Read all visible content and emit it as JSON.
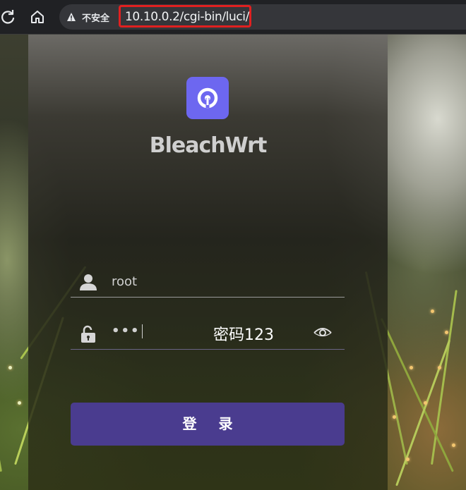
{
  "browser": {
    "insecure_label": "不安全",
    "url": "10.10.0.2/cgi-bin/luci/"
  },
  "login": {
    "brand": "BleachWrt",
    "username_value": "root",
    "password_mask": "•••",
    "annotation": "密码123",
    "login_label": "登 录"
  },
  "colors": {
    "accent": "#4a3c8f",
    "logo": "#6d67f0",
    "highlight_box": "#e02020"
  },
  "icons": [
    "back-icon",
    "home-icon",
    "warning-icon",
    "logo-icon",
    "user-icon",
    "unlock-icon",
    "eye-icon"
  ]
}
